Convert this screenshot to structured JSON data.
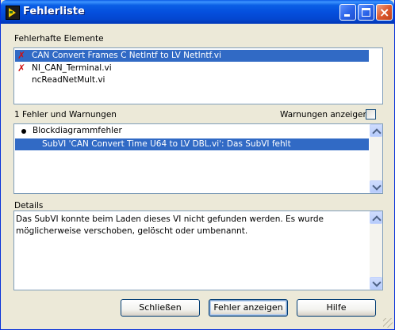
{
  "window": {
    "title": "Fehlerliste"
  },
  "error_elements": {
    "label": "Fehlerhafte Elemente",
    "items": [
      {
        "text": "CAN Convert Frames C NetIntf to LV NetIntf.vi",
        "has_error": true,
        "selected": true
      },
      {
        "text": "NI_CAN_Terminal.vi",
        "has_error": true,
        "selected": false
      },
      {
        "text": "ncReadNetMult.vi",
        "has_error": false,
        "selected": false
      }
    ]
  },
  "warnings": {
    "count_label": "1 Fehler und Warnungen",
    "show_warnings_label": "Warnungen anzeigen",
    "show_warnings_checked": false,
    "items": [
      {
        "text": "Blockdiagrammfehler",
        "type": "category"
      },
      {
        "text": "SubVI 'CAN Convert Time U64 to LV DBL.vi': Das SubVI fehlt",
        "type": "error",
        "selected": true
      }
    ]
  },
  "details": {
    "label": "Details",
    "text": "Das SubVI konnte beim Laden dieses VI nicht gefunden werden. Es wurde möglicherweise verschoben, gelöscht oder umbenannt."
  },
  "buttons": {
    "close": "Schließen",
    "show_error": "Fehler anzeigen",
    "help": "Hilfe"
  },
  "icons": {
    "app": "labview-icon",
    "error_mark": "✗"
  },
  "colors": {
    "selection": "#316ac5",
    "error": "#d01010"
  }
}
